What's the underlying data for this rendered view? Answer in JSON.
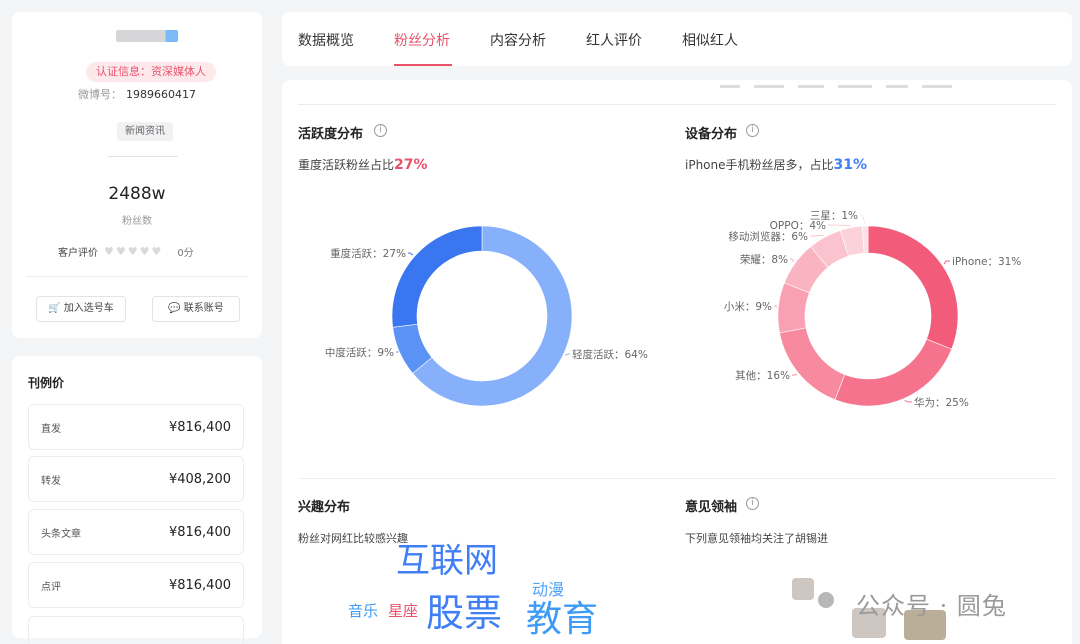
{
  "profile": {
    "auth_badge": "认证信息：资深媒体人",
    "weibo_label": "微博号：",
    "weibo_id": "1989660417",
    "category_tag": "新闻资讯",
    "fans_count": "2488w",
    "fans_label": "粉丝数",
    "rating_label": "客户评价",
    "rating_score": "0分",
    "hearts": "♥♥♥♥♥",
    "add_cart_label": "加入选号车",
    "contact_label": "联系账号"
  },
  "prices": {
    "title": "刊例价",
    "items": [
      {
        "label": "直发",
        "value": "¥816,400"
      },
      {
        "label": "转发",
        "value": "¥408,200"
      },
      {
        "label": "头条文章",
        "value": "¥816,400"
      },
      {
        "label": "点评",
        "value": "¥816,400"
      }
    ]
  },
  "tabs": [
    {
      "label": "数据概览",
      "active": false
    },
    {
      "label": "粉丝分析",
      "active": true
    },
    {
      "label": "内容分析",
      "active": false
    },
    {
      "label": "红人评价",
      "active": false
    },
    {
      "label": "相似红人",
      "active": false
    }
  ],
  "activity": {
    "title": "活跃度分布",
    "sub_prefix": "重度活跃粉丝占比",
    "sub_value": "27%"
  },
  "device": {
    "title": "设备分布",
    "sub_prefix": "iPhone手机粉丝居多，占比",
    "sub_value": "31%"
  },
  "interest": {
    "title": "兴趣分布",
    "sub": "粉丝对网红比较感兴趣"
  },
  "opinion": {
    "title": "意见领袖",
    "sub": "下列意见领袖均关注了胡锡进"
  },
  "chart_data": [
    {
      "type": "pie",
      "title": "活跃度分布",
      "donut": true,
      "labels": [
        "重度活跃",
        "中度活跃",
        "轻度活跃"
      ],
      "values": [
        27,
        9,
        64
      ],
      "display": [
        "重度活跃：27%",
        "中度活跃：9%",
        "轻度活跃：64%"
      ],
      "colors": [
        "#3a76ef",
        "#5b93f5",
        "#86b0fa"
      ]
    },
    {
      "type": "pie",
      "title": "设备分布",
      "donut": true,
      "labels": [
        "iPhone",
        "华为",
        "其他",
        "小米",
        "荣耀",
        "移动浏览器",
        "OPPO",
        "三星"
      ],
      "values": [
        31,
        25,
        16,
        9,
        8,
        6,
        4,
        1
      ],
      "display": [
        "iPhone：31%",
        "华为：25%",
        "其他：16%",
        "小米：9%",
        "荣耀：8%",
        "移动浏览器：6%",
        "OPPO：4%",
        "三星：1%"
      ],
      "colors": [
        "#f25c7a",
        "#f5738c",
        "#f78a9f",
        "#f9a1b2",
        "#fab4c1",
        "#fbc3ce",
        "#fcd2da",
        "#fde0e6"
      ]
    }
  ],
  "word_cloud": [
    {
      "text": "互联网",
      "color": "#3f7ef5",
      "size": 34
    },
    {
      "text": "动漫",
      "color": "#4fa3f7",
      "size": 16
    },
    {
      "text": "音乐",
      "color": "#3f9bf5",
      "size": 15
    },
    {
      "text": "星座",
      "color": "#e8536b",
      "size": 15
    },
    {
      "text": "股票",
      "color": "#3f7ef5",
      "size": 38
    },
    {
      "text": "教育",
      "color": "#3f9bf5",
      "size": 36
    }
  ],
  "watermark": {
    "text": "公众号 · 圆兔"
  },
  "icons": {
    "cart": "cart-icon",
    "chat": "chat-icon",
    "info": "info-icon"
  }
}
